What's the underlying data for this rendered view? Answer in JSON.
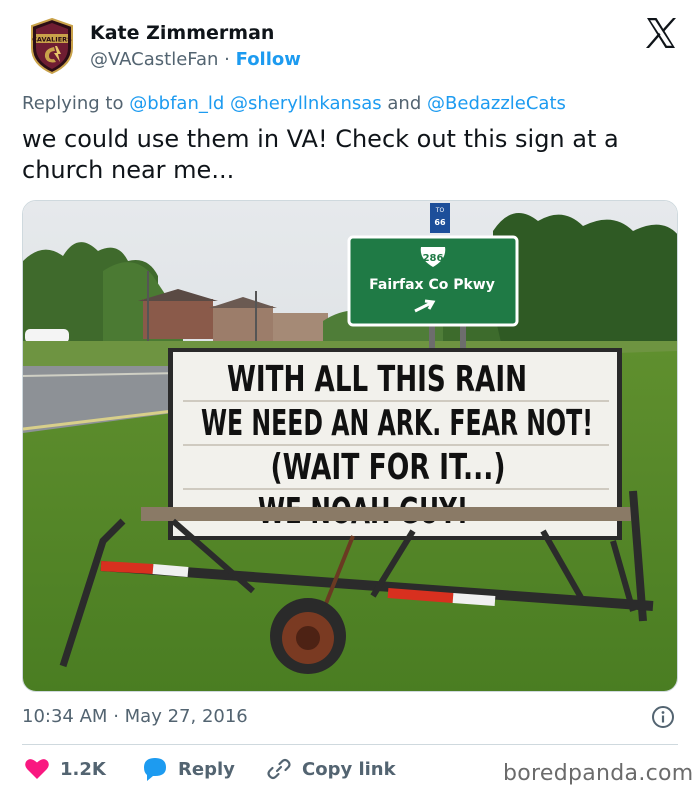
{
  "author": {
    "name": "Kate Zimmerman",
    "handle": "@VACastleFan",
    "separator": "·",
    "follow_label": "Follow",
    "avatar_text": "CAVALIERS"
  },
  "reply": {
    "prefix": "Replying to",
    "mentions": [
      "@bbfan_ld",
      "@sheryllnkansas",
      "@BedazzleCats"
    ],
    "and": "and"
  },
  "tweet_text": "we could use them in VA!  Check out this sign at a church near me...",
  "photo": {
    "interstate_top": "TO",
    "interstate_num": "66",
    "route_num": "286",
    "road_sign_text": "Fairfax Co Pkwy",
    "sign_lines": [
      "WITH ALL THIS RAIN",
      "WE NEED AN ARK. FEAR NOT!",
      "(WAIT FOR IT...)",
      "WE NOAH GUY!"
    ]
  },
  "timestamp": {
    "time": "10:34 AM",
    "separator": "·",
    "date": "May 27, 2016"
  },
  "actions": {
    "likes": "1.2K",
    "reply_label": "Reply",
    "copy_link_label": "Copy link"
  },
  "watermark": "boredpanda.com",
  "colors": {
    "accent": "#1d9bf0",
    "like": "#f91880",
    "muted": "#536471",
    "road_sign_green": "#1f7a45"
  },
  "icons": [
    "cavaliers-logo-avatar",
    "x-logo-icon",
    "info-icon",
    "heart-icon",
    "reply-bubble-icon",
    "link-icon"
  ]
}
